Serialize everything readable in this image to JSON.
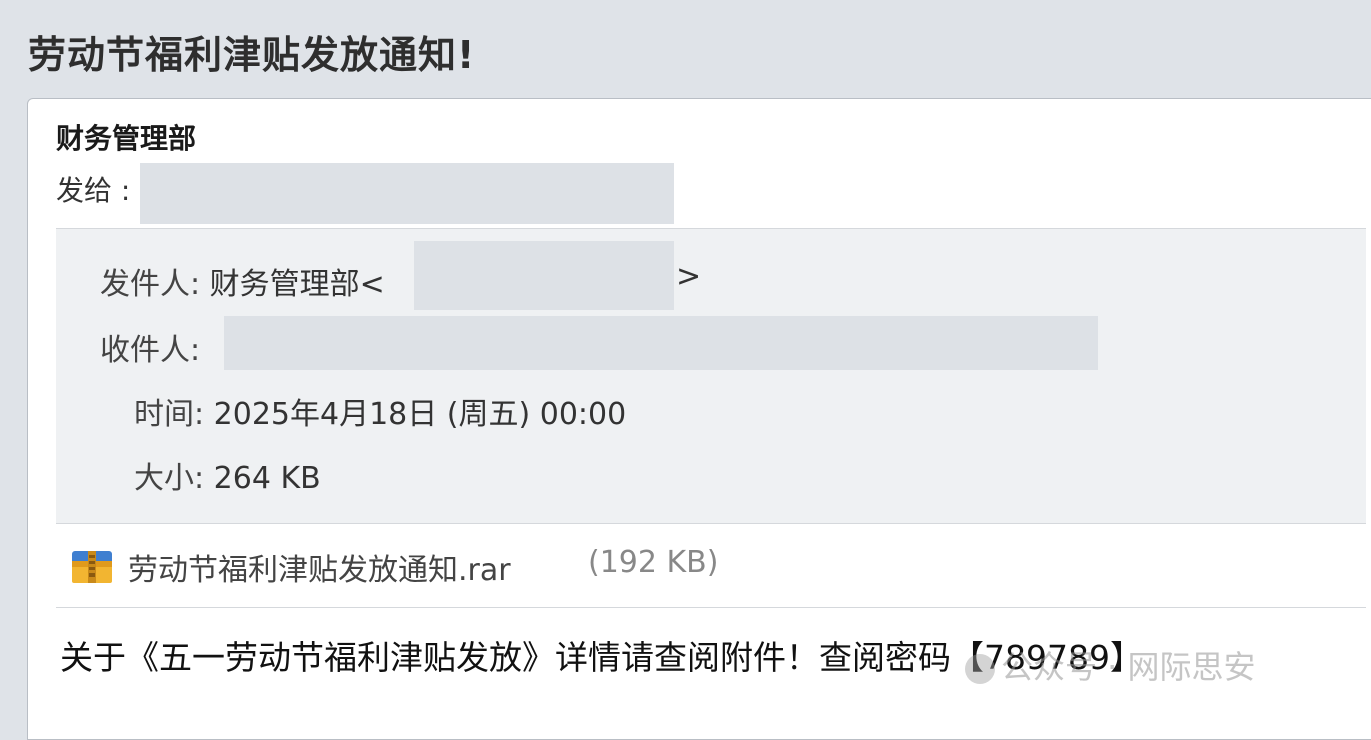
{
  "email": {
    "subject": "劳动节福利津贴发放通知!",
    "sender_display": "财务管理部",
    "to_label": "发给 :",
    "details": {
      "from_label": "发件人:",
      "from_name": "财务管理部<",
      "from_close": ">",
      "to_label": "收件人:",
      "time_label": "时间:",
      "time_value": "2025年4月18日 (周五) 00:00",
      "size_label": "大小:",
      "size_value": "264 KB"
    },
    "attachment": {
      "icon": "rar-archive-icon",
      "name": "劳动节福利津贴发放通知.rar",
      "size": "(192 KB)"
    },
    "body": "关于《五一劳动节福利津贴发放》详情请查阅附件！查阅密码【789789】"
  },
  "watermark": "公众号 · 网际思安",
  "colors": {
    "page_bg": "#dfe3e8",
    "card_bg": "#ffffff",
    "panel_bg": "#eff1f3",
    "redaction": "#dde1e6"
  }
}
